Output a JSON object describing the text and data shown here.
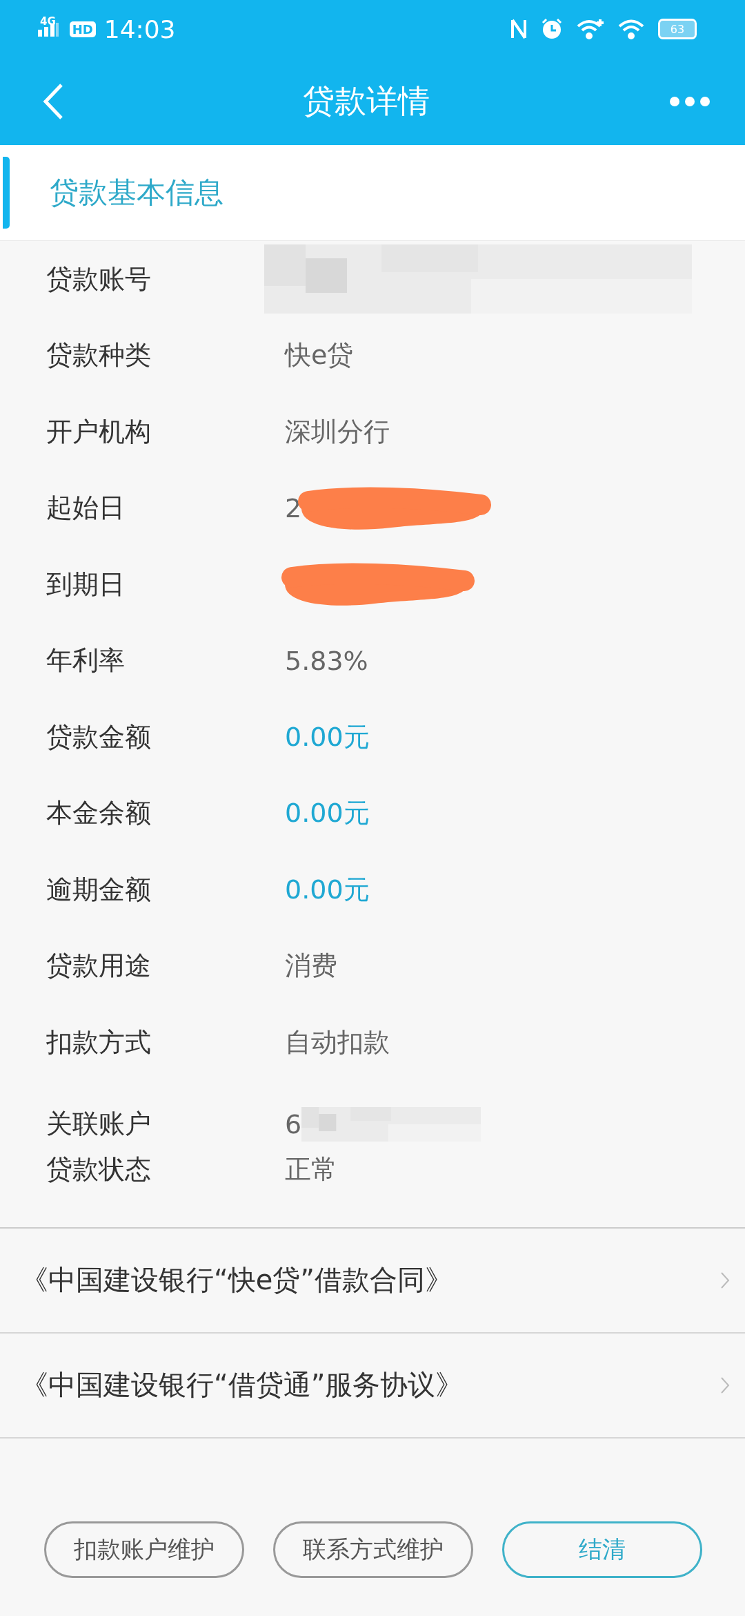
{
  "status_bar": {
    "network": "4G",
    "hd": "HD",
    "time": "14:03",
    "battery": "63"
  },
  "header": {
    "title": "贷款详情"
  },
  "section": {
    "title": "贷款基本信息"
  },
  "fields": [
    {
      "label": "贷款账号",
      "kind": "blurred"
    },
    {
      "label": "贷款种类",
      "value": "快e贷",
      "kind": "plain",
      "highlight": false
    },
    {
      "label": "开户机构",
      "value": "深圳分行",
      "kind": "plain",
      "highlight": false
    },
    {
      "label": "起始日",
      "value": "2",
      "kind": "scribbled"
    },
    {
      "label": "到期日",
      "kind": "scribbled"
    },
    {
      "label": "年利率",
      "value": "5.83%",
      "kind": "plain",
      "highlight": false
    },
    {
      "label": "贷款金额",
      "value": "0.00元",
      "kind": "plain",
      "highlight": true
    },
    {
      "label": "本金余额",
      "value": "0.00元",
      "kind": "plain",
      "highlight": true
    },
    {
      "label": "逾期金额",
      "value": "0.00元",
      "kind": "plain",
      "highlight": true
    },
    {
      "label": "贷款用途",
      "value": "消费",
      "kind": "plain",
      "highlight": false
    },
    {
      "label": "扣款方式",
      "value": "自动扣款",
      "kind": "plain",
      "highlight": false
    }
  ],
  "compact_fields": [
    {
      "label": "关联账户",
      "value": "6",
      "kind": "blurred"
    },
    {
      "label": "贷款状态",
      "value": "正常",
      "kind": "plain"
    }
  ],
  "agreements": [
    "《中国建设银行“快e贷”借款合同》",
    "《中国建设银行“借贷通”服务协议》"
  ],
  "buttons": [
    {
      "label": "扣款账户维护",
      "kind": "outline"
    },
    {
      "label": "联系方式维护",
      "kind": "outline"
    },
    {
      "label": "结清",
      "kind": "primary"
    }
  ]
}
